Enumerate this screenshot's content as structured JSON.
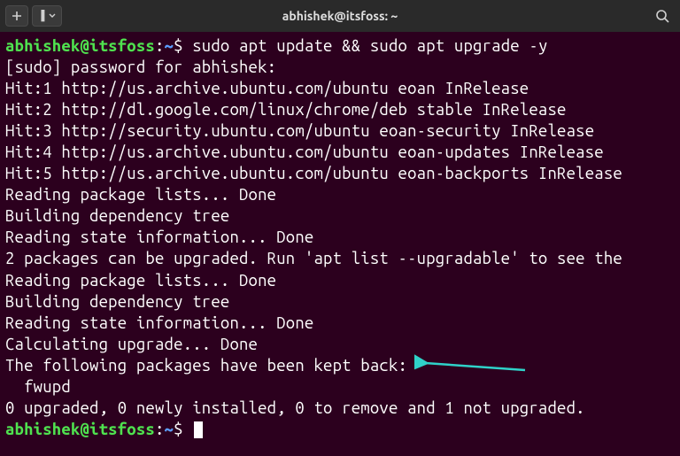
{
  "window": {
    "title": "abhishek@itsfoss: ~"
  },
  "prompt": {
    "user": "abhishek@itsfoss",
    "sep1": ":",
    "path": "~",
    "sep2": "$"
  },
  "command": "sudo apt update && sudo apt upgrade -y",
  "output_lines": [
    "[sudo] password for abhishek:",
    "Hit:1 http://us.archive.ubuntu.com/ubuntu eoan InRelease",
    "Hit:2 http://dl.google.com/linux/chrome/deb stable InRelease",
    "Hit:3 http://security.ubuntu.com/ubuntu eoan-security InRelease",
    "Hit:4 http://us.archive.ubuntu.com/ubuntu eoan-updates InRelease",
    "Hit:5 http://us.archive.ubuntu.com/ubuntu eoan-backports InRelease",
    "Reading package lists... Done",
    "Building dependency tree",
    "Reading state information... Done",
    "2 packages can be upgraded. Run 'apt list --upgradable' to see the",
    "Reading package lists... Done",
    "Building dependency tree",
    "Reading state information... Done",
    "Calculating upgrade... Done",
    "The following packages have been kept back:",
    "  fwupd",
    "0 upgraded, 0 newly installed, 0 to remove and 1 not upgraded."
  ],
  "icons": {
    "new_tab": "⊞",
    "dropdown_chevron": "▾",
    "search": "⌕"
  },
  "annotation": {
    "arrow_color": "#2fd2c9"
  }
}
